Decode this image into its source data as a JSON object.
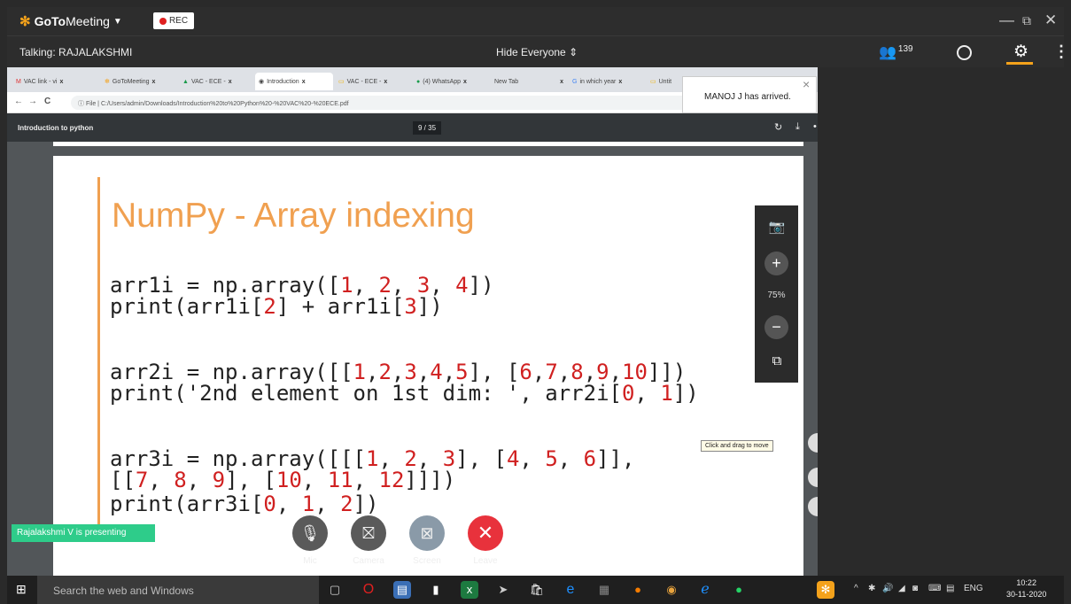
{
  "titlebar": {
    "app_name_1": "GoTo",
    "app_name_2": "Meeting",
    "rec_label": "REC"
  },
  "subbar": {
    "talking": "Talking: RAJALAKSHMI",
    "hide_everyone": "Hide Everyone",
    "attendee_count": "139"
  },
  "browser": {
    "tabs": [
      {
        "label": "VAC link - vi",
        "close": "x"
      },
      {
        "label": "GoToMeeting",
        "close": "x"
      },
      {
        "label": "VAC - ECE -",
        "close": "x"
      },
      {
        "label": "Introduction",
        "close": "x"
      },
      {
        "label": "VAC - ECE -",
        "close": "x"
      },
      {
        "label": "(4) WhatsApp",
        "close": "x"
      },
      {
        "label": "New Tab",
        "close": "x"
      },
      {
        "label": "in which year",
        "close": "x"
      },
      {
        "label": "Untit",
        "close": ""
      }
    ],
    "url": "C:/Users/admin/Downloads/Introduction%20to%20Python%20-%20VAC%20-%20ECE.pdf",
    "url_prefix": "File"
  },
  "pdf": {
    "title": "Introduction to python",
    "page": "9 / 35"
  },
  "slide": {
    "title": "NumPy - Array indexing",
    "code": [
      [
        "arr1i = np.array([",
        "1",
        ", ",
        "2",
        ", ",
        "3",
        ", ",
        "4",
        "])"
      ],
      [
        "print(arr1i[",
        "2",
        "] + arr1i[",
        "3",
        "])"
      ],
      [
        "arr2i = np.array([[",
        "1",
        ",",
        "2",
        ",",
        "3",
        ",",
        "4",
        ",",
        "5",
        "], [",
        "6",
        ",",
        "7",
        ",",
        "8",
        ",",
        "9",
        ",",
        "10",
        "]])"
      ],
      [
        "print('2nd element on 1st dim: ', arr2i[",
        "0",
        ", ",
        "1",
        "])"
      ],
      [
        "arr3i = np.array([[[",
        "1",
        ", ",
        "2",
        ", ",
        "3",
        "], [",
        "4",
        ", ",
        "5",
        ", ",
        "6",
        "]],"
      ],
      [
        "[[",
        "7",
        ", ",
        "8",
        ", ",
        "9",
        "], [",
        "10",
        ", ",
        "11",
        ", ",
        "12",
        "]]])"
      ],
      [
        "print(arr3i[",
        "0",
        ", ",
        "1",
        ", ",
        "2",
        "])"
      ]
    ]
  },
  "toast": {
    "message": "MANOJ J has arrived.",
    "close": "×"
  },
  "zoom": {
    "percent": "75%"
  },
  "tooltip": "Click and drag to move",
  "presenting": "Rajalakshmi V is presenting",
  "controls": {
    "mic": "Mic",
    "camera": "Camera",
    "screen": "Screen",
    "leave": "Leave"
  },
  "taskbar": {
    "search_placeholder": "Search the web and Windows",
    "lang": "ENG",
    "time": "10:22",
    "date": "30-11-2020"
  },
  "colors": {
    "accent": "#f4a21b",
    "leave": "#e8323c",
    "presenting": "#2ecc8a",
    "slide_title": "#f0a050"
  }
}
